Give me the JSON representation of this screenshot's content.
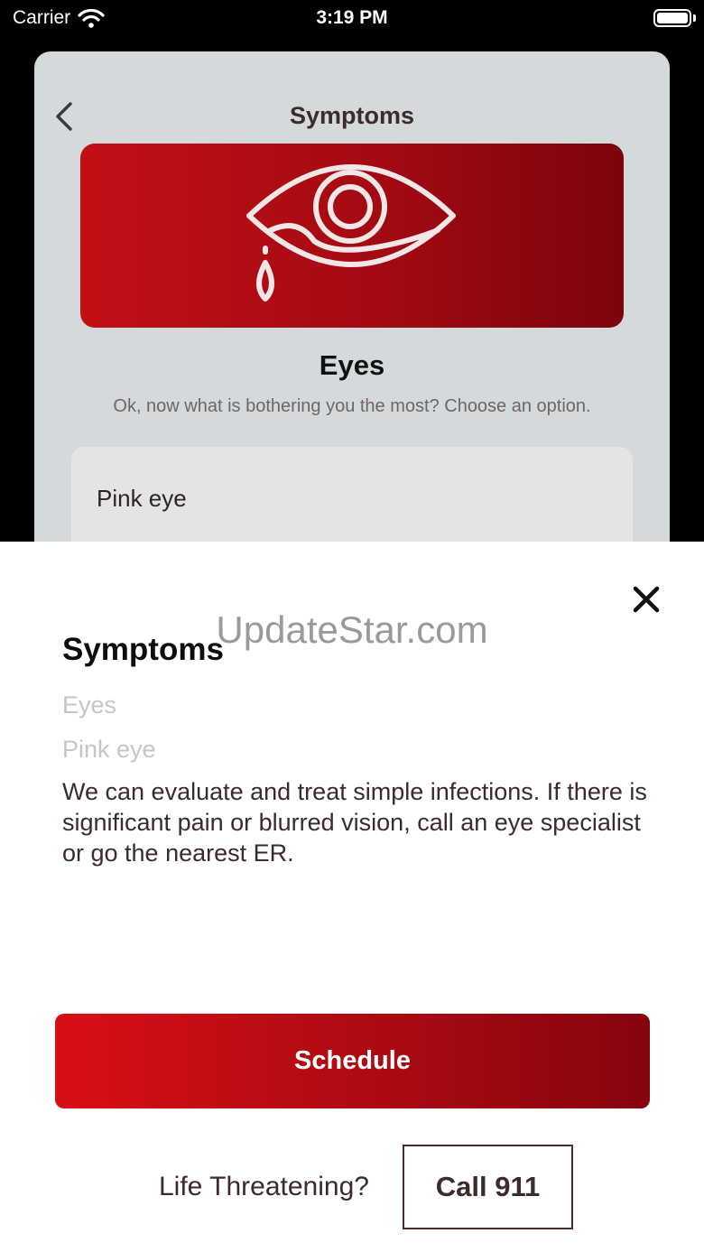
{
  "status_bar": {
    "carrier": "Carrier",
    "time": "3:19 PM"
  },
  "background_screen": {
    "nav_title": "Symptoms",
    "heading": "Eyes",
    "subtitle": "Ok, now what is bothering you the most? Choose an option.",
    "option_label": "Pink eye",
    "hero_icon": "crying-eye-icon"
  },
  "sheet": {
    "watermark": "UpdateStar.com",
    "title": "Symptoms",
    "breadcrumb_category": "Eyes",
    "breadcrumb_symptom": "Pink eye",
    "description": "We can evaluate and treat simple infections. If there is significant pain or blurred vision, call an eye specialist or go the nearest ER.",
    "schedule_label": "Schedule",
    "life_threatening_label": "Life Threatening?",
    "call_label": "Call 911"
  },
  "colors": {
    "brand_red": "#c30f16",
    "brand_dark_red": "#7c040c"
  }
}
